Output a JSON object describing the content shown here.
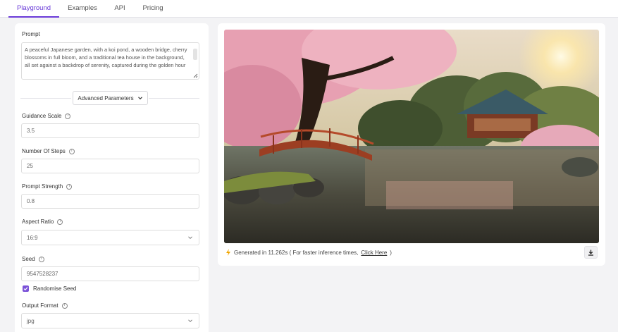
{
  "tabs": [
    {
      "label": "Playground",
      "active": true
    },
    {
      "label": "Examples",
      "active": false
    },
    {
      "label": "API",
      "active": false
    },
    {
      "label": "Pricing",
      "active": false
    }
  ],
  "form": {
    "prompt_label": "Prompt",
    "prompt_value": "A peaceful Japanese garden, with a koi pond, a wooden bridge, cherry blossoms in full bloom, and a traditional tea house in the background, all set against a backdrop of serenity, captured during the golden hour",
    "advanced_label": "Advanced Parameters",
    "guidance_label": "Guidance Scale",
    "guidance_value": "3.5",
    "steps_label": "Number Of Steps",
    "steps_value": "25",
    "strength_label": "Prompt Strength",
    "strength_value": "0.8",
    "aspect_label": "Aspect Ratio",
    "aspect_value": "16:9",
    "seed_label": "Seed",
    "seed_value": "9547528237",
    "randomise_label": "Randomise Seed",
    "randomise_checked": true,
    "format_label": "Output Format",
    "format_value": "jpg"
  },
  "result": {
    "generated_prefix": "Generated in 11.262s ( For faster inference times,",
    "link_label": "Click Here",
    "generated_suffix": ")"
  },
  "colors": {
    "accent": "#6a3bd8",
    "checkbox": "#7b52d8",
    "bolt": "#f0a500"
  },
  "icons": {
    "info": "info-icon",
    "chevron": "chevron-down-icon",
    "bolt": "bolt-icon",
    "download": "download-icon",
    "check": "check-icon"
  }
}
